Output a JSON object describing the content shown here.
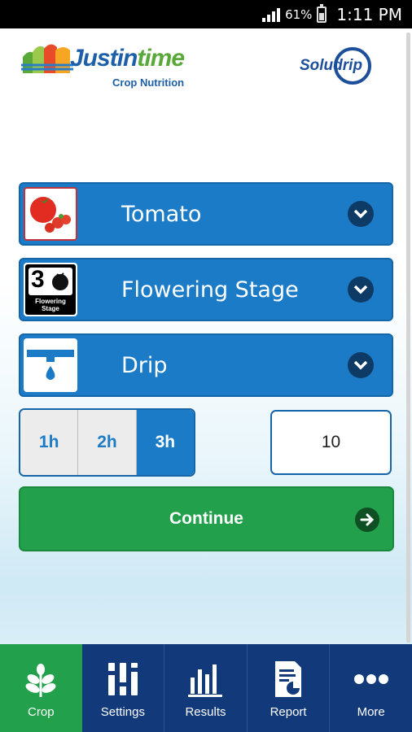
{
  "status_bar": {
    "battery": "61%",
    "time": "1:11 PM"
  },
  "logos": {
    "left_brand_a": "Justin",
    "left_brand_b": "time",
    "left_sub": "Crop Nutrition",
    "right_brand": "Soludrip"
  },
  "selectors": [
    {
      "label": "Tomato",
      "icon": "tomato-icon"
    },
    {
      "label": "Flowering Stage",
      "icon": "flowering-stage-icon",
      "stage_number": "3",
      "stage_text": "Flowering Stage"
    },
    {
      "label": "Drip",
      "icon": "drip-icon"
    }
  ],
  "duration": {
    "options": [
      "1h",
      "2h",
      "3h"
    ],
    "selected": "3h"
  },
  "amount": {
    "value": "10"
  },
  "continue_label": "Continue",
  "tabs": [
    {
      "label": "Crop",
      "icon": "leaf-icon",
      "active": true
    },
    {
      "label": "Settings",
      "icon": "sliders-icon",
      "active": false
    },
    {
      "label": "Results",
      "icon": "bar-chart-icon",
      "active": false
    },
    {
      "label": "Report",
      "icon": "report-icon",
      "active": false
    },
    {
      "label": "More",
      "icon": "more-icon",
      "active": false
    }
  ],
  "colors": {
    "primary_blue": "#1b7bc7",
    "green": "#22a04b",
    "nav_blue": "#12397a"
  }
}
